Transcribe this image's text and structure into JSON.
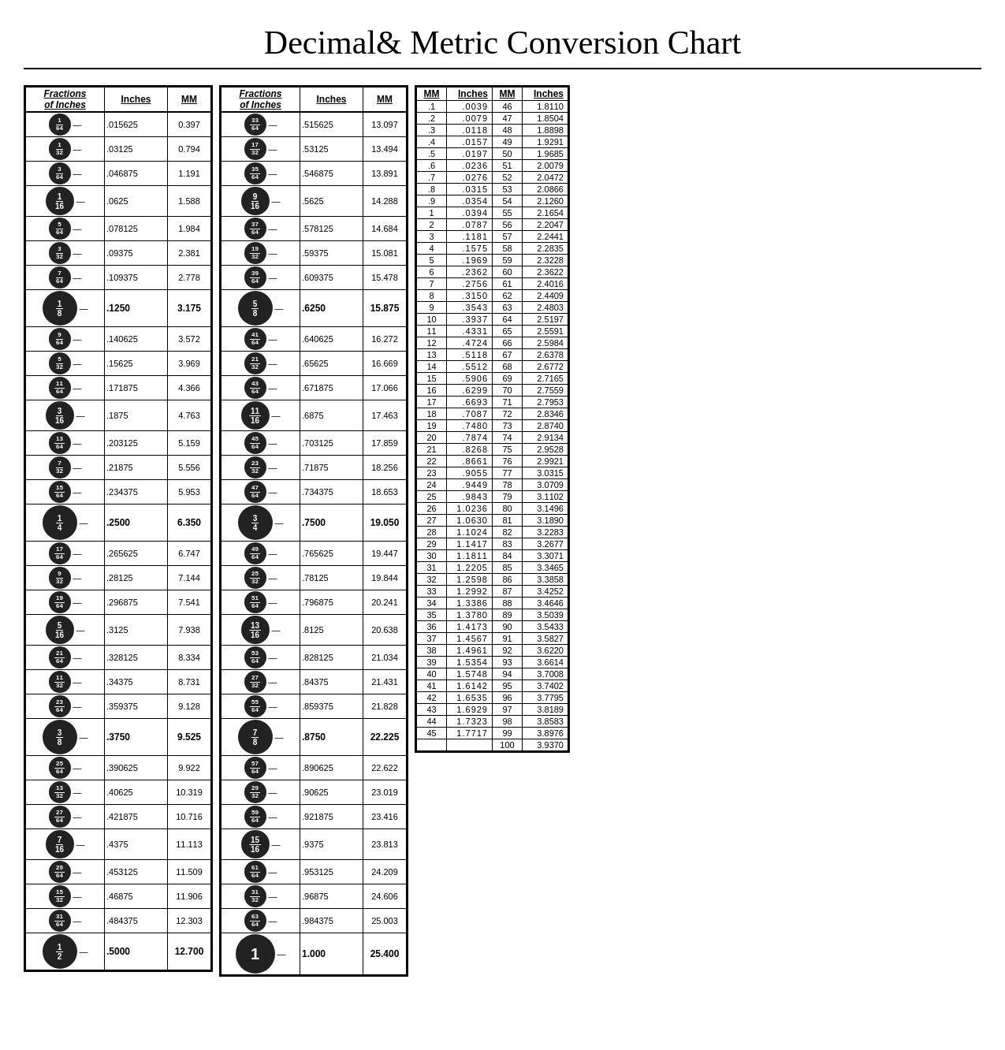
{
  "title": "Decimal& Metric Conversion Chart",
  "left_table": {
    "headers": [
      "Fractions of Inches",
      "Inches",
      "MM"
    ],
    "rows": [
      {
        "frac_num": "1",
        "frac_den": "64",
        "size": "sm",
        "inches": ".015625",
        "mm": "0.397"
      },
      {
        "frac_num": "1",
        "frac_den": "32",
        "size": "sm",
        "inches": ".03125",
        "mm": "0.794"
      },
      {
        "frac_num": "3",
        "frac_den": "64",
        "size": "sm",
        "inches": ".046875",
        "mm": "1.191"
      },
      {
        "frac_num": "1",
        "frac_den": "16",
        "size": "md",
        "inches": ".0625",
        "mm": "1.588"
      },
      {
        "frac_num": "5",
        "frac_den": "64",
        "size": "sm",
        "inches": ".078125",
        "mm": "1.984"
      },
      {
        "frac_num": "3",
        "frac_den": "32",
        "size": "sm",
        "inches": ".09375",
        "mm": "2.381"
      },
      {
        "frac_num": "7",
        "frac_den": "64",
        "size": "sm",
        "inches": ".109375",
        "mm": "2.778"
      },
      {
        "frac_num": "1",
        "frac_den": "8",
        "size": "lg",
        "inches": ".1250",
        "mm": "3.175"
      },
      {
        "frac_num": "9",
        "frac_den": "64",
        "size": "sm",
        "inches": ".140625",
        "mm": "3.572"
      },
      {
        "frac_num": "5",
        "frac_den": "32",
        "size": "sm",
        "inches": ".15625",
        "mm": "3.969"
      },
      {
        "frac_num": "11",
        "frac_den": "64",
        "size": "sm",
        "inches": ".171875",
        "mm": "4.366"
      },
      {
        "frac_num": "3",
        "frac_den": "16",
        "size": "md",
        "inches": ".1875",
        "mm": "4.763"
      },
      {
        "frac_num": "13",
        "frac_den": "64",
        "size": "sm",
        "inches": ".203125",
        "mm": "5.159"
      },
      {
        "frac_num": "7",
        "frac_den": "32",
        "size": "sm",
        "inches": ".21875",
        "mm": "5.556"
      },
      {
        "frac_num": "15",
        "frac_den": "64",
        "size": "sm",
        "inches": ".234375",
        "mm": "5.953"
      },
      {
        "frac_num": "1",
        "frac_den": "4",
        "size": "lg",
        "inches": ".2500",
        "mm": "6.350"
      },
      {
        "frac_num": "17",
        "frac_den": "64",
        "size": "sm",
        "inches": ".265625",
        "mm": "6.747"
      },
      {
        "frac_num": "9",
        "frac_den": "32",
        "size": "sm",
        "inches": ".28125",
        "mm": "7.144"
      },
      {
        "frac_num": "19",
        "frac_den": "64",
        "size": "sm",
        "inches": ".296875",
        "mm": "7.541"
      },
      {
        "frac_num": "5",
        "frac_den": "16",
        "size": "md",
        "inches": ".3125",
        "mm": "7.938"
      },
      {
        "frac_num": "21",
        "frac_den": "64",
        "size": "sm",
        "inches": ".328125",
        "mm": "8.334"
      },
      {
        "frac_num": "11",
        "frac_den": "32",
        "size": "sm",
        "inches": ".34375",
        "mm": "8.731"
      },
      {
        "frac_num": "23",
        "frac_den": "64",
        "size": "sm",
        "inches": ".359375",
        "mm": "9.128"
      },
      {
        "frac_num": "3",
        "frac_den": "8",
        "size": "lg",
        "inches": ".3750",
        "mm": "9.525"
      },
      {
        "frac_num": "25",
        "frac_den": "64",
        "size": "sm",
        "inches": ".390625",
        "mm": "9.922"
      },
      {
        "frac_num": "13",
        "frac_den": "32",
        "size": "sm",
        "inches": ".40625",
        "mm": "10.319"
      },
      {
        "frac_num": "27",
        "frac_den": "64",
        "size": "sm",
        "inches": ".421875",
        "mm": "10.716"
      },
      {
        "frac_num": "7",
        "frac_den": "16",
        "size": "md",
        "inches": ".4375",
        "mm": "11.113"
      },
      {
        "frac_num": "29",
        "frac_den": "64",
        "size": "sm",
        "inches": ".453125",
        "mm": "11.509"
      },
      {
        "frac_num": "15",
        "frac_den": "32",
        "size": "sm",
        "inches": ".46875",
        "mm": "11.906"
      },
      {
        "frac_num": "31",
        "frac_den": "64",
        "size": "sm",
        "inches": ".484375",
        "mm": "12.303"
      },
      {
        "frac_num": "1",
        "frac_den": "2",
        "size": "lg",
        "inches": ".5000",
        "mm": "12.700"
      }
    ]
  },
  "right_table": {
    "headers": [
      "Fractions of Inches",
      "Inches",
      "MM"
    ],
    "rows": [
      {
        "frac_num": "33",
        "frac_den": "64",
        "size": "sm",
        "inches": ".515625",
        "mm": "13.097"
      },
      {
        "frac_num": "17",
        "frac_den": "32",
        "size": "sm",
        "inches": ".53125",
        "mm": "13.494"
      },
      {
        "frac_num": "35",
        "frac_den": "64",
        "size": "sm",
        "inches": ".546875",
        "mm": "13.891"
      },
      {
        "frac_num": "9",
        "frac_den": "16",
        "size": "md",
        "inches": ".5625",
        "mm": "14.288"
      },
      {
        "frac_num": "37",
        "frac_den": "64",
        "size": "sm",
        "inches": ".578125",
        "mm": "14.684"
      },
      {
        "frac_num": "19",
        "frac_den": "32",
        "size": "sm",
        "inches": ".59375",
        "mm": "15.081"
      },
      {
        "frac_num": "39",
        "frac_den": "64",
        "size": "sm",
        "inches": ".609375",
        "mm": "15.478"
      },
      {
        "frac_num": "5",
        "frac_den": "8",
        "size": "lg",
        "inches": ".6250",
        "mm": "15.875"
      },
      {
        "frac_num": "41",
        "frac_den": "64",
        "size": "sm",
        "inches": ".640625",
        "mm": "16.272"
      },
      {
        "frac_num": "21",
        "frac_den": "32",
        "size": "sm",
        "inches": ".65625",
        "mm": "16.669"
      },
      {
        "frac_num": "43",
        "frac_den": "64",
        "size": "sm",
        "inches": ".671875",
        "mm": "17.066"
      },
      {
        "frac_num": "11",
        "frac_den": "16",
        "size": "md",
        "inches": ".6875",
        "mm": "17.463"
      },
      {
        "frac_num": "45",
        "frac_den": "64",
        "size": "sm",
        "inches": ".703125",
        "mm": "17.859"
      },
      {
        "frac_num": "23",
        "frac_den": "32",
        "size": "sm",
        "inches": ".71875",
        "mm": "18.256"
      },
      {
        "frac_num": "47",
        "frac_den": "64",
        "size": "sm",
        "inches": ".734375",
        "mm": "18.653"
      },
      {
        "frac_num": "3",
        "frac_den": "4",
        "size": "lg",
        "inches": ".7500",
        "mm": "19.050"
      },
      {
        "frac_num": "49",
        "frac_den": "64",
        "size": "sm",
        "inches": ".765625",
        "mm": "19.447"
      },
      {
        "frac_num": "25",
        "frac_den": "32",
        "size": "sm",
        "inches": ".78125",
        "mm": "19.844"
      },
      {
        "frac_num": "51",
        "frac_den": "64",
        "size": "sm",
        "inches": ".796875",
        "mm": "20.241"
      },
      {
        "frac_num": "13",
        "frac_den": "16",
        "size": "md",
        "inches": ".8125",
        "mm": "20.638"
      },
      {
        "frac_num": "53",
        "frac_den": "64",
        "size": "sm",
        "inches": ".828125",
        "mm": "21.034"
      },
      {
        "frac_num": "27",
        "frac_den": "32",
        "size": "sm",
        "inches": ".84375",
        "mm": "21.431"
      },
      {
        "frac_num": "55",
        "frac_den": "64",
        "size": "sm",
        "inches": ".859375",
        "mm": "21.828"
      },
      {
        "frac_num": "7",
        "frac_den": "8",
        "size": "lg",
        "inches": ".8750",
        "mm": "22.225"
      },
      {
        "frac_num": "57",
        "frac_den": "64",
        "size": "sm",
        "inches": ".890625",
        "mm": "22.622"
      },
      {
        "frac_num": "29",
        "frac_den": "32",
        "size": "sm",
        "inches": ".90625",
        "mm": "23.019"
      },
      {
        "frac_num": "59",
        "frac_den": "64",
        "size": "sm",
        "inches": ".921875",
        "mm": "23.416"
      },
      {
        "frac_num": "15",
        "frac_den": "16",
        "size": "md",
        "inches": ".9375",
        "mm": "23.813"
      },
      {
        "frac_num": "61",
        "frac_den": "64",
        "size": "sm",
        "inches": ".953125",
        "mm": "24.209"
      },
      {
        "frac_num": "31",
        "frac_den": "32",
        "size": "sm",
        "inches": ".96875",
        "mm": "24.606"
      },
      {
        "frac_num": "63",
        "frac_den": "64",
        "size": "sm",
        "inches": ".984375",
        "mm": "25.003"
      },
      {
        "frac_num": "1",
        "frac_den": "",
        "size": "xl",
        "inches": "1.000",
        "mm": "25.400"
      }
    ]
  },
  "mm_inches_table": {
    "col1_header_mm": "MM",
    "col1_header_in": "Inches",
    "col2_header_mm": "MM",
    "col2_header_in": "Inches",
    "rows": [
      [
        ".1",
        ".0039",
        "46",
        "1.8110"
      ],
      [
        ".2",
        ".0079",
        "47",
        "1.8504"
      ],
      [
        ".3",
        ".0118",
        "48",
        "1.8898"
      ],
      [
        ".4",
        ".0157",
        "49",
        "1.9291"
      ],
      [
        ".5",
        ".0197",
        "50",
        "1.9685"
      ],
      [
        ".6",
        ".0236",
        "51",
        "2.0079"
      ],
      [
        ".7",
        ".0276",
        "52",
        "2.0472"
      ],
      [
        ".8",
        ".0315",
        "53",
        "2.0866"
      ],
      [
        ".9",
        ".0354",
        "54",
        "2.1260"
      ],
      [
        "1",
        ".0394",
        "55",
        "2.1654"
      ],
      [
        "2",
        ".0787",
        "56",
        "2.2047"
      ],
      [
        "3",
        ".1181",
        "57",
        "2.2441"
      ],
      [
        "4",
        ".1575",
        "58",
        "2.2835"
      ],
      [
        "5",
        ".1969",
        "59",
        "2.3228"
      ],
      [
        "6",
        ".2362",
        "60",
        "2.3622"
      ],
      [
        "7",
        ".2756",
        "61",
        "2.4016"
      ],
      [
        "8",
        ".3150",
        "62",
        "2.4409"
      ],
      [
        "9",
        ".3543",
        "63",
        "2.4803"
      ],
      [
        "10",
        ".3937",
        "64",
        "2.5197"
      ],
      [
        "11",
        ".4331",
        "65",
        "2.5591"
      ],
      [
        "12",
        ".4724",
        "66",
        "2.5984"
      ],
      [
        "13",
        ".5118",
        "67",
        "2.6378"
      ],
      [
        "14",
        ".5512",
        "68",
        "2.6772"
      ],
      [
        "15",
        ".5906",
        "69",
        "2.7165"
      ],
      [
        "16",
        ".6299",
        "70",
        "2.7559"
      ],
      [
        "17",
        ".6693",
        "71",
        "2.7953"
      ],
      [
        "18",
        ".7087",
        "72",
        "2.8346"
      ],
      [
        "19",
        ".7480",
        "73",
        "2.8740"
      ],
      [
        "20",
        ".7874",
        "74",
        "2.9134"
      ],
      [
        "21",
        ".8268",
        "75",
        "2.9528"
      ],
      [
        "22",
        ".8661",
        "76",
        "2.9921"
      ],
      [
        "23",
        ".9055",
        "77",
        "3.0315"
      ],
      [
        "24",
        ".9449",
        "78",
        "3.0709"
      ],
      [
        "25",
        ".9843",
        "79",
        "3.1102"
      ],
      [
        "26",
        "1.0236",
        "80",
        "3.1496"
      ],
      [
        "27",
        "1.0630",
        "81",
        "3.1890"
      ],
      [
        "28",
        "1.1024",
        "82",
        "3.2283"
      ],
      [
        "29",
        "1.1417",
        "83",
        "3.2677"
      ],
      [
        "30",
        "1.1811",
        "84",
        "3.3071"
      ],
      [
        "31",
        "1.2205",
        "85",
        "3.3465"
      ],
      [
        "32",
        "1.2598",
        "86",
        "3.3858"
      ],
      [
        "33",
        "1.2992",
        "87",
        "3.4252"
      ],
      [
        "34",
        "1.3386",
        "88",
        "3.4646"
      ],
      [
        "35",
        "1.3780",
        "89",
        "3.5039"
      ],
      [
        "36",
        "1.4173",
        "90",
        "3.5433"
      ],
      [
        "37",
        "1.4567",
        "91",
        "3.5827"
      ],
      [
        "38",
        "1.4961",
        "92",
        "3.6220"
      ],
      [
        "39",
        "1.5354",
        "93",
        "3.6614"
      ],
      [
        "40",
        "1.5748",
        "94",
        "3.7008"
      ],
      [
        "41",
        "1.6142",
        "95",
        "3.7402"
      ],
      [
        "42",
        "1.6535",
        "96",
        "3.7795"
      ],
      [
        "43",
        "1.6929",
        "97",
        "3.8189"
      ],
      [
        "44",
        "1.7323",
        "98",
        "3.8583"
      ],
      [
        "45",
        "1.7717",
        "99",
        "3.8976"
      ],
      [
        "",
        "",
        "100",
        "3.9370"
      ]
    ]
  }
}
